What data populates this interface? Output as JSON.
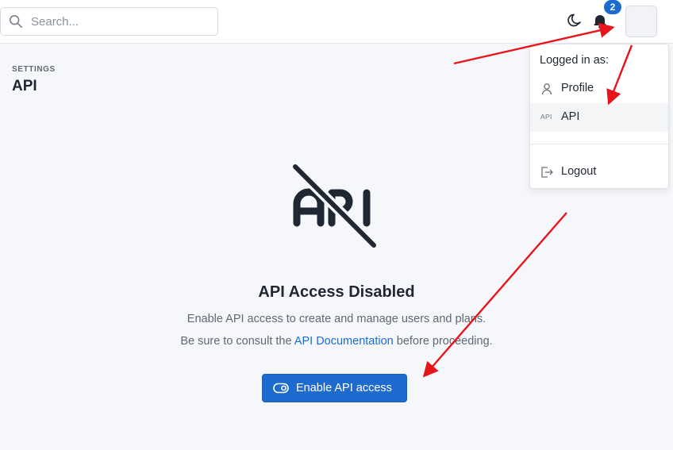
{
  "header": {
    "search": {
      "placeholder": "Search..."
    },
    "notifications": {
      "count": "2"
    }
  },
  "page": {
    "breadcrumb": "SETTINGS",
    "title": "API"
  },
  "empty_state": {
    "title": "API Access Disabled",
    "line1": "Enable API access to create and manage users and plans.",
    "line2_prefix": "Be sure to consult the ",
    "line2_link": "API Documentation",
    "line2_suffix": " before proceeding.",
    "button_label": "Enable API access"
  },
  "user_menu": {
    "heading": "Logged in as:",
    "items": [
      {
        "label": "Profile",
        "icon": "user-icon"
      },
      {
        "label": "API",
        "icon": "api-icon",
        "icon_text": "API",
        "active": true
      },
      {
        "label": "Logout",
        "icon": "logout-icon"
      }
    ]
  },
  "colors": {
    "primary": "#1e6bd0",
    "annotation_arrow": "#e8141b"
  }
}
